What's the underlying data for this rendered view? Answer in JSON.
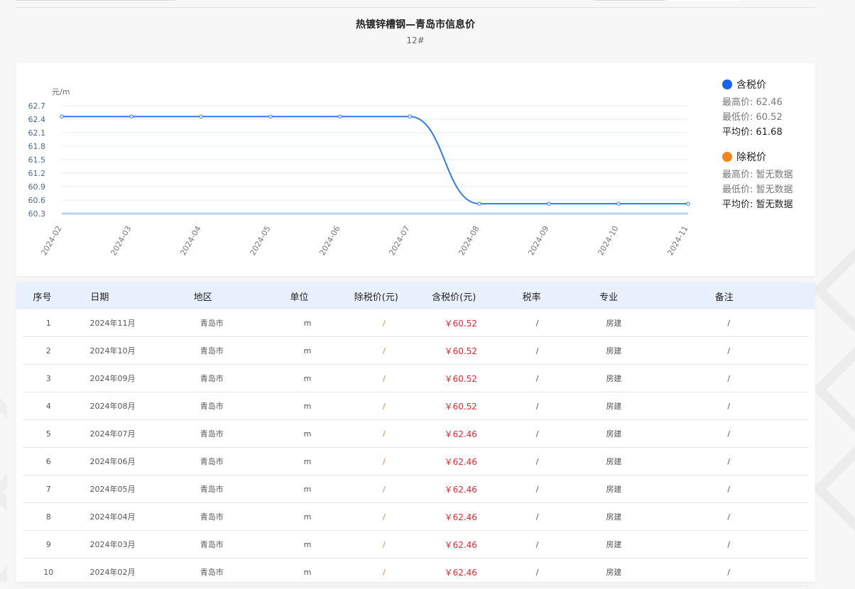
{
  "page": {
    "title": "热镀锌槽钢—青岛市信息价",
    "subtitle": "12#"
  },
  "colors": {
    "tax_included": "#1463f5",
    "tax_excluded": "#f5841f",
    "price_red": "#f5222d",
    "header_bg": "#e9f0fd"
  },
  "legend": {
    "tax_included": {
      "label": "含税价",
      "max": "最高价: 62.46",
      "min": "最低价: 60.52",
      "avg": "平均价: 61.68"
    },
    "tax_excluded": {
      "label": "除税价",
      "max": "最高价: 暂无数据",
      "min": "最低价: 暂无数据",
      "avg": "平均价: 暂无数据"
    }
  },
  "chart_data": {
    "type": "line",
    "ylabel": "元/m",
    "ylim": [
      60.3,
      62.7
    ],
    "yticks": [
      "62.7",
      "62.4",
      "62.1",
      "61.8",
      "61.5",
      "61.2",
      "60.9",
      "60.6",
      "60.3"
    ],
    "categories": [
      "2024-02",
      "2024-03",
      "2024-04",
      "2024-05",
      "2024-06",
      "2024-07",
      "2024-08",
      "2024-09",
      "2024-10",
      "2024-11"
    ],
    "series": [
      {
        "name": "含税价",
        "values": [
          62.46,
          62.46,
          62.46,
          62.46,
          62.46,
          62.46,
          60.52,
          60.52,
          60.52,
          60.52
        ]
      }
    ],
    "grid": true,
    "legend_position": "right"
  },
  "table": {
    "headers": [
      "序号",
      "日期",
      "地区",
      "单位",
      "除税价(元)",
      "含税价(元)",
      "税率",
      "专业",
      "备注"
    ],
    "rows": [
      [
        "1",
        "2024年11月",
        "青岛市",
        "m",
        "/",
        "￥60.52",
        "/",
        "房建",
        "/"
      ],
      [
        "2",
        "2024年10月",
        "青岛市",
        "m",
        "/",
        "￥60.52",
        "/",
        "房建",
        "/"
      ],
      [
        "3",
        "2024年09月",
        "青岛市",
        "m",
        "/",
        "￥60.52",
        "/",
        "房建",
        "/"
      ],
      [
        "4",
        "2024年08月",
        "青岛市",
        "m",
        "/",
        "￥60.52",
        "/",
        "房建",
        "/"
      ],
      [
        "5",
        "2024年07月",
        "青岛市",
        "m",
        "/",
        "￥62.46",
        "/",
        "房建",
        "/"
      ],
      [
        "6",
        "2024年06月",
        "青岛市",
        "m",
        "/",
        "￥62.46",
        "/",
        "房建",
        "/"
      ],
      [
        "7",
        "2024年05月",
        "青岛市",
        "m",
        "/",
        "￥62.46",
        "/",
        "房建",
        "/"
      ],
      [
        "8",
        "2024年04月",
        "青岛市",
        "m",
        "/",
        "￥62.46",
        "/",
        "房建",
        "/"
      ],
      [
        "9",
        "2024年03月",
        "青岛市",
        "m",
        "/",
        "￥62.46",
        "/",
        "房建",
        "/"
      ],
      [
        "10",
        "2024年02月",
        "青岛市",
        "m",
        "/",
        "￥62.46",
        "/",
        "房建",
        "/"
      ]
    ]
  }
}
